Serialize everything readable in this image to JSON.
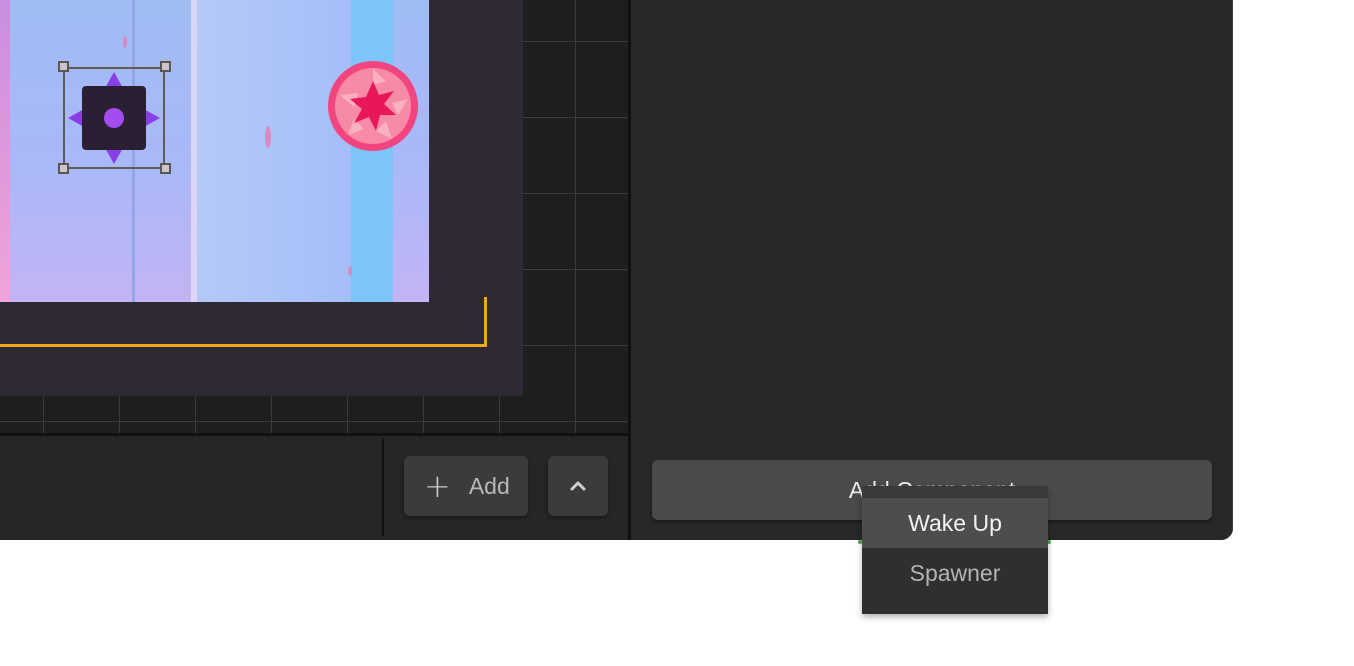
{
  "toolbar": {
    "add_label": "Add",
    "add_icon": "plus-icon",
    "collapse_icon": "chevron-up-icon"
  },
  "inspector": {
    "add_component_label": "Add Component"
  },
  "component_menu": {
    "items": [
      {
        "label": "Wake Up",
        "selected": true
      },
      {
        "label": "Spawner",
        "selected": false
      }
    ]
  },
  "colors": {
    "bounds": "#f2a81d",
    "saw": "#f2457f",
    "spike": "#8a3ee8"
  }
}
